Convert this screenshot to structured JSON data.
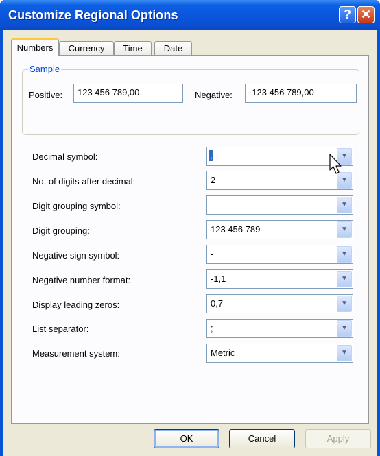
{
  "window": {
    "title": "Customize Regional Options"
  },
  "title_buttons": {
    "help": "?",
    "close": "✕"
  },
  "tabs": [
    {
      "label": "Numbers",
      "active": true
    },
    {
      "label": "Currency",
      "active": false
    },
    {
      "label": "Time",
      "active": false
    },
    {
      "label": "Date",
      "active": false
    }
  ],
  "sample": {
    "group_label": "Sample",
    "positive_label": "Positive:",
    "positive_value": "123 456 789,00",
    "negative_label": "Negative:",
    "negative_value": "-123 456 789,00"
  },
  "settings": [
    {
      "label": "Decimal symbol:",
      "value": ","
    },
    {
      "label": "No. of digits after decimal:",
      "value": "2"
    },
    {
      "label": "Digit grouping symbol:",
      "value": ""
    },
    {
      "label": "Digit grouping:",
      "value": "123 456 789"
    },
    {
      "label": "Negative sign symbol:",
      "value": "-"
    },
    {
      "label": "Negative number format:",
      "value": "-1,1"
    },
    {
      "label": "Display leading zeros:",
      "value": "0,7"
    },
    {
      "label": "List separator:",
      "value": ";"
    },
    {
      "label": "Measurement system:",
      "value": "Metric"
    }
  ],
  "buttons": {
    "ok": "OK",
    "cancel": "Cancel",
    "apply": "Apply"
  },
  "colors": {
    "titlebar": "#0a55dc",
    "dialog_bg": "#ece9d8",
    "group_label": "#0046d5",
    "selection": "#316ac5"
  },
  "icons": {
    "dropdown": "chevron-down-icon",
    "help": "help-icon",
    "close": "close-icon"
  }
}
